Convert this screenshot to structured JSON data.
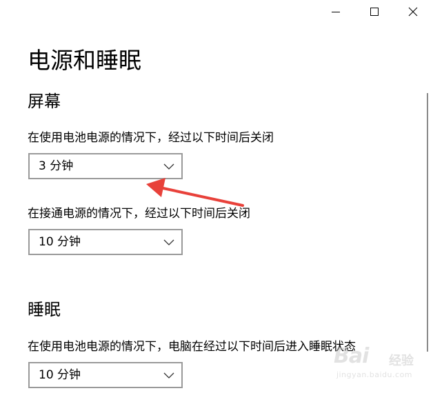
{
  "window": {
    "minimize_label": "Minimize",
    "maximize_label": "Maximize",
    "close_label": "Close"
  },
  "page": {
    "title": "电源和睡眠"
  },
  "screen": {
    "heading": "屏幕",
    "battery_label": "在使用电池电源的情况下，经过以下时间后关闭",
    "battery_value": "3 分钟",
    "plugged_label": "在接通电源的情况下，经过以下时间后关闭",
    "plugged_value": "10 分钟"
  },
  "sleep": {
    "heading": "睡眠",
    "battery_label": "在使用电池电源的情况下，电脑在经过以下时间后进入睡眠状态",
    "battery_value": "10 分钟"
  },
  "annotation": {
    "arrow_color": "#e8413a"
  },
  "watermark": {
    "brand": "Bai",
    "sub": "经验",
    "url": "jingyan.baidu.com"
  },
  "colors": {
    "dropdown_border": "#999999",
    "text": "#000000",
    "background": "#ffffff"
  }
}
